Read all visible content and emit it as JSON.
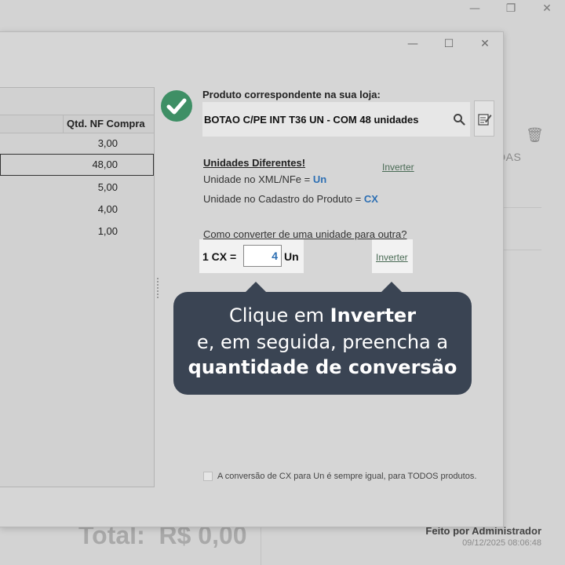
{
  "background": {
    "total_label": "Total:",
    "total_value": "R$ 0,00",
    "partial_text": "DAS",
    "user_text": "Feito por Administrador",
    "datetime": "09/12/2025 08:06:48"
  },
  "table": {
    "column_header": "Qtd. NF Compra",
    "rows": [
      "3,00",
      "48,00",
      "5,00",
      "4,00",
      "1,00"
    ]
  },
  "product": {
    "label": "Produto correspondente na sua loja:",
    "name": "BOTAO C/PE INT T36 UN - COM 48 unidades"
  },
  "units": {
    "title": "Unidades Diferentes!",
    "invert_link": "Inverter",
    "xml_label": "Unidade no XML/NFe =",
    "xml_unit": "Un",
    "cadastro_label": "Unidade no Cadastro do Produto =",
    "cadastro_unit": "CX"
  },
  "conversion": {
    "question": "Como converter de uma unidade para outra?",
    "prefix": "1 CX =",
    "value": "4",
    "suffix": "Un",
    "invert_label": "Inverter"
  },
  "tooltip": {
    "line1_pre": "Clique em ",
    "line1_bold": "Inverter",
    "line2": "e, em seguida, preencha a",
    "line3": "quantidade de conversão"
  },
  "footer": {
    "note": "A conversão de CX para Un é sempre igual, para TODOS produtos."
  },
  "colors": {
    "accent_blue": "#2d6fb3",
    "check_green": "#3e8f65",
    "tooltip_bg": "#3a4453"
  }
}
